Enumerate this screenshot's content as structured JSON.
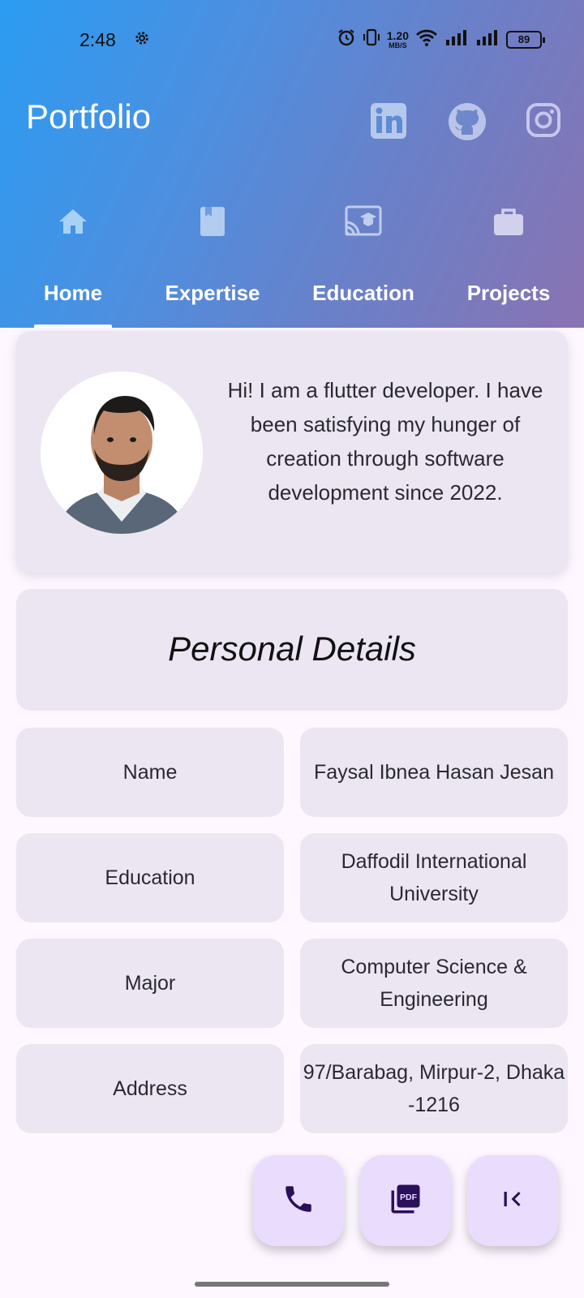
{
  "status_bar": {
    "time": "2:48",
    "network_speed_top": "1.20",
    "network_speed_bottom": "MB/S",
    "battery": "89",
    "icons": [
      "settings-gear-icon",
      "alarm-icon",
      "vibrate-icon",
      "wifi-icon",
      "signal-icon",
      "signal-icon",
      "battery-icon"
    ]
  },
  "app_bar": {
    "title": "Portfolio",
    "actions": [
      "linkedin-icon",
      "github-icon",
      "instagram-icon"
    ]
  },
  "tabs": [
    {
      "label": "Home",
      "icon": "home-icon",
      "selected": true
    },
    {
      "label": "Expertise",
      "icon": "book-icon",
      "selected": false
    },
    {
      "label": "Education",
      "icon": "school-cast-icon",
      "selected": false
    },
    {
      "label": "Projects",
      "icon": "briefcase-icon",
      "selected": false
    }
  ],
  "intro": {
    "text": "Hi! I am a flutter developer. I have been satisfying my hunger of creation through software development since 2022."
  },
  "personal_details": {
    "title": "Personal Details",
    "rows": [
      {
        "label": "Name",
        "value": "Faysal Ibnea Hasan Jesan"
      },
      {
        "label": "Education",
        "value": "Daffodil International University"
      },
      {
        "label": "Major",
        "value": "Computer Science & Engineering"
      },
      {
        "label": "Address",
        "value": "97/Barabag, Mirpur-2, Dhaka -1216"
      }
    ]
  },
  "fabs": [
    "phone-icon",
    "pdf-icon",
    "first-page-icon"
  ],
  "colors": {
    "gradient_start": "#2a9cf2",
    "gradient_end": "#8a73b2",
    "card_bg": "#ece6f3",
    "fab_bg": "#eadcfd",
    "fab_icon": "#2a0f5a"
  }
}
